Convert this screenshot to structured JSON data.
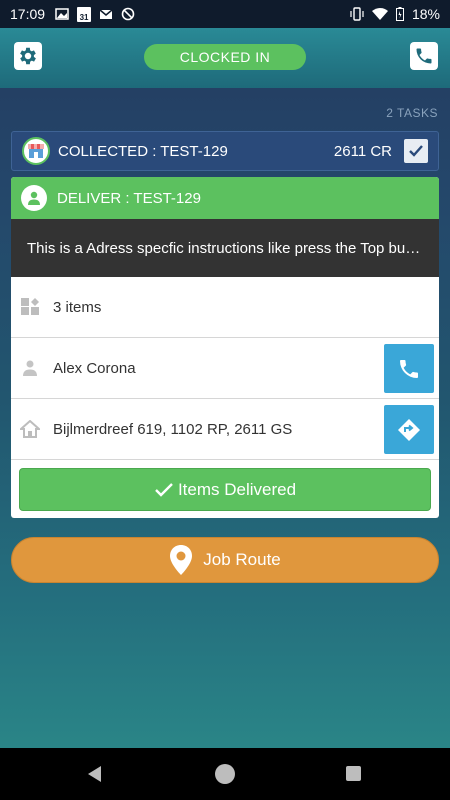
{
  "status_bar": {
    "time": "17:09",
    "calendar_day": "31",
    "battery": "18%"
  },
  "app_bar": {
    "clock_status": "CLOCKED IN",
    "settings_icon": "gear-icon",
    "phone_icon": "phone-icon"
  },
  "tasks": {
    "count_label": "2 TASKS"
  },
  "collected": {
    "label": "COLLECTED : TEST-129",
    "postal_code": "2611 CR",
    "checked": true
  },
  "deliver": {
    "title": "DELIVER : TEST-129",
    "instructions": "This is a Adress specfic instructions like press the Top button on the door",
    "items": "3 items",
    "customer": "Alex Corona",
    "address": "Bijlmerdreef 619, 1102 RP, 2611 GS",
    "delivered_label": "Items Delivered"
  },
  "route": {
    "label": "Job Route"
  },
  "colors": {
    "green": "#5cc15f",
    "blue_action": "#3aa7d8",
    "orange": "#e0973d",
    "navy": "#2a4a7a"
  }
}
